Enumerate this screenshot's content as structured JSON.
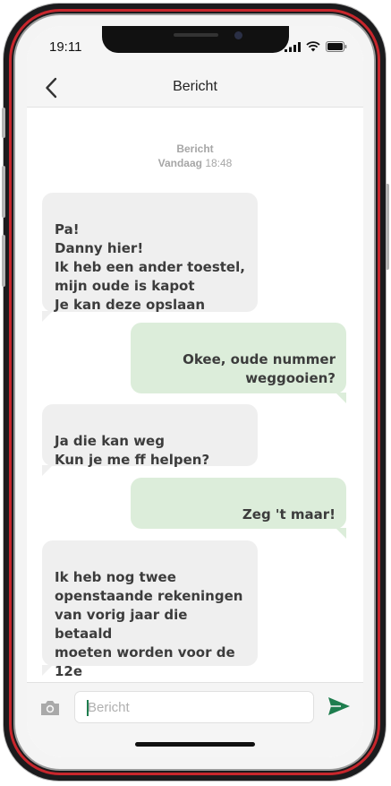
{
  "status": {
    "time": "19:11",
    "icons": [
      "signal-icon",
      "wifi-icon",
      "battery-icon"
    ]
  },
  "header": {
    "title": "Bericht",
    "back_icon": "chevron-left-icon"
  },
  "thread": {
    "label": "Bericht",
    "day": "Vandaag",
    "time": "18:48"
  },
  "messages": [
    {
      "direction": "in",
      "text": "Pa!\nDanny hier!\nIk heb een ander toestel,\nmijn oude is kapot\nJe kan deze opslaan"
    },
    {
      "direction": "out",
      "text": "Okee, oude nummer\nweggooien?"
    },
    {
      "direction": "in",
      "text": "Ja die kan weg\nKun je me ff helpen?"
    },
    {
      "direction": "out",
      "text": "Zeg 't maar!"
    },
    {
      "direction": "in",
      "text": "Ik heb nog twee\nopenstaande rekeningen\nvan vorig jaar die betaald\nmoeten worden voor de\n12e"
    }
  ],
  "composer": {
    "placeholder": "Bericht",
    "value": "",
    "camera_icon": "camera-icon",
    "send_icon": "send-icon"
  },
  "colors": {
    "frame_accent": "#c8262c",
    "incoming_bubble": "#efefef",
    "outgoing_bubble": "#dcedda",
    "send_accent": "#1e7d4e"
  }
}
